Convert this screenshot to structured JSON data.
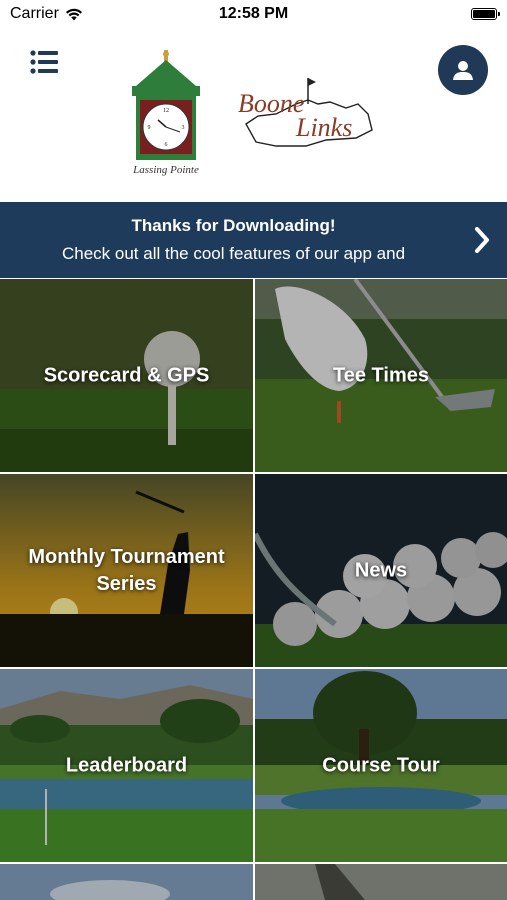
{
  "status_bar": {
    "carrier": "Carrier",
    "time": "12:58 PM",
    "battery_level": 1.0
  },
  "header": {
    "menu_icon": "hamburger-menu-icon",
    "profile_icon": "user-icon",
    "logo_left_caption": "Lassing Pointe",
    "logo_right_text_1": "Boone",
    "logo_right_text_2": "Links",
    "brand_color": "#1f3957"
  },
  "banner": {
    "title": "Thanks for Downloading!",
    "text": "Check out all the cool features of our app and",
    "chevron_icon": "chevron-right-icon",
    "color": "#1f3b5c"
  },
  "tiles": [
    {
      "label": "Scorecard & GPS"
    },
    {
      "label": "Tee Times"
    },
    {
      "label": "Monthly Tournament Series"
    },
    {
      "label": "News"
    },
    {
      "label": "Leaderboard"
    },
    {
      "label": "Course Tour"
    }
  ]
}
